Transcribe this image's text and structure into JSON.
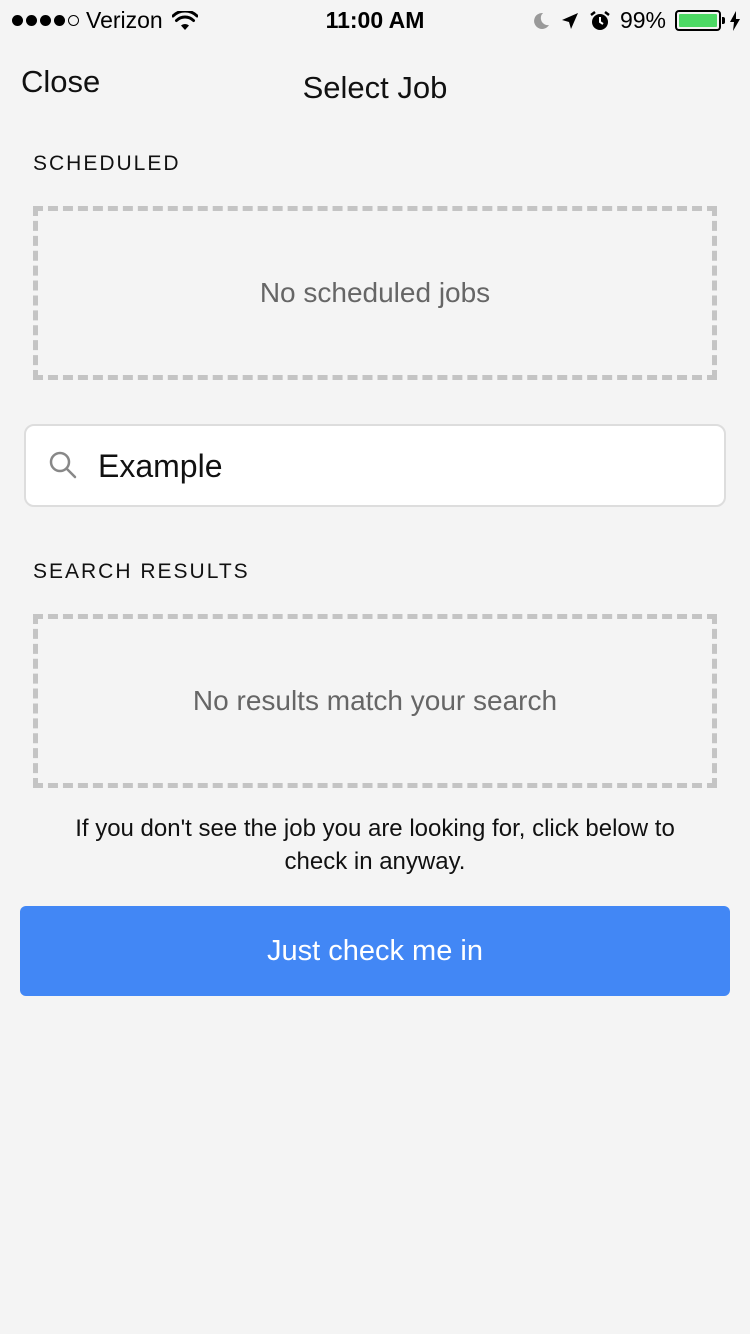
{
  "status_bar": {
    "carrier": "Verizon",
    "time": "11:00 AM",
    "battery_percent": "99%",
    "battery_level": 0.99,
    "icons": [
      "signal-dots-icon",
      "wifi-icon",
      "moon-icon",
      "location-arrow-icon",
      "alarm-icon",
      "battery-icon",
      "charging-bolt-icon"
    ]
  },
  "nav": {
    "close_label": "Close",
    "title": "Select Job"
  },
  "scheduled": {
    "label": "SCHEDULED",
    "empty_text": "No scheduled jobs"
  },
  "search": {
    "value": "Example"
  },
  "results": {
    "label": "SEARCH RESULTS",
    "empty_text": "No results match your search"
  },
  "help_text": "If you don't see the job you are looking for, click below to check in anyway.",
  "check_in_button": "Just check me in",
  "colors": {
    "background": "#f4f4f4",
    "accent": "#4287f5",
    "battery": "#4cd964"
  }
}
